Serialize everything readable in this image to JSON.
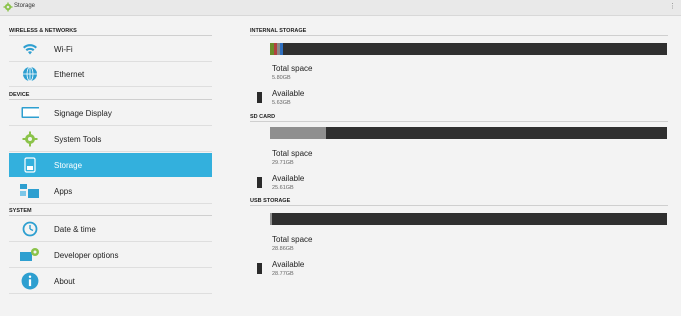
{
  "window": {
    "title": "Storage",
    "overflow_icon": "overflow-menu-icon"
  },
  "sidebar": {
    "sections": [
      {
        "label": "WIRELESS & NETWORKS"
      },
      {
        "label": "DEVICE"
      },
      {
        "label": "SYSTEM"
      }
    ],
    "items": [
      {
        "label": "Wi-Fi",
        "icon": "wifi-icon"
      },
      {
        "label": "Ethernet",
        "icon": "globe-icon"
      },
      {
        "label": "Signage Display",
        "icon": "display-icon"
      },
      {
        "label": "System Tools",
        "icon": "gear-icon"
      },
      {
        "label": "Storage",
        "icon": "storage-icon",
        "selected": true
      },
      {
        "label": "Apps",
        "icon": "apps-icon"
      },
      {
        "label": "Date & time",
        "icon": "clock-icon"
      },
      {
        "label": "Developer options",
        "icon": "developer-gear-icon"
      },
      {
        "label": "About",
        "icon": "info-icon"
      }
    ]
  },
  "storage": {
    "sections": [
      {
        "header": "INTERNAL STORAGE",
        "used_fraction": 0.03,
        "total_label": "Total space",
        "total_value": "5.80GB",
        "available_label": "Available",
        "available_value": "5.63GB"
      },
      {
        "header": "SD CARD",
        "used_fraction": 0.14,
        "total_label": "Total space",
        "total_value": "29.71GB",
        "available_label": "Available",
        "available_value": "25.61GB"
      },
      {
        "header": "USB STORAGE",
        "used_fraction": 0.005,
        "total_label": "Total space",
        "total_value": "28.86GB",
        "available_label": "Available",
        "available_value": "28.77GB"
      }
    ]
  },
  "colors": {
    "accent": "#33b0dd",
    "bar_empty": "#2f2f2f",
    "bar_used": "#8f8f8f",
    "usage_segments": [
      "#6b8c2a",
      "#b0413e",
      "#8a8a8a",
      "#2f6fbf"
    ]
  }
}
